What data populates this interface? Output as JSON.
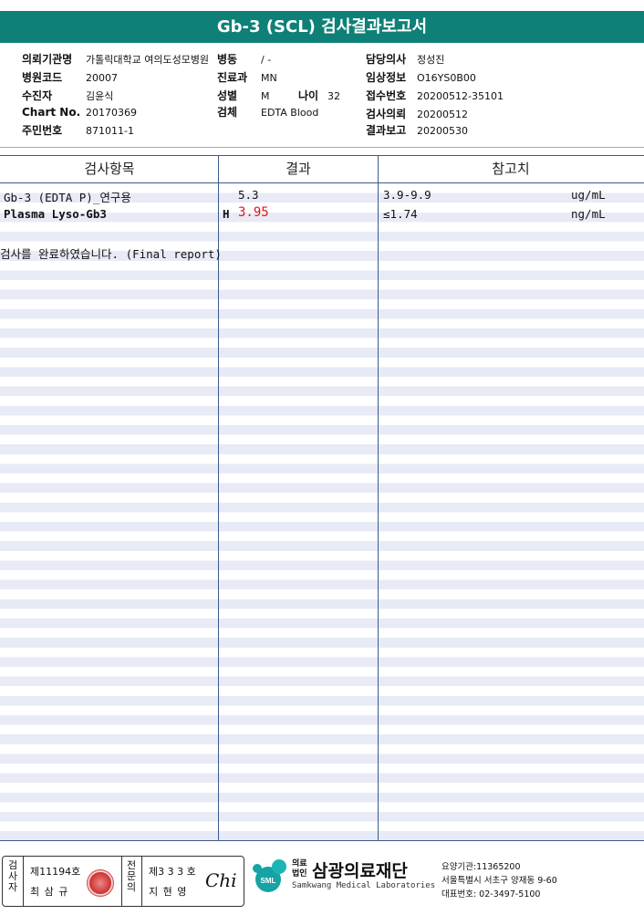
{
  "title": "Gb-3 (SCL) 검사결과보고서",
  "header": {
    "left": [
      {
        "key": "의뢰기관명",
        "value": "가톨릭대학교 여의도성모병원"
      },
      {
        "key": "병원코드",
        "value": "20007"
      },
      {
        "key": "수진자",
        "value": "김윤식"
      },
      {
        "key": "Chart No.",
        "value": "20170369"
      },
      {
        "key": "주민번호",
        "value": "871011-1"
      }
    ],
    "middle": [
      {
        "key": "병동",
        "value": "/ -"
      },
      {
        "key": "진료과",
        "value": "MN"
      },
      {
        "key": "성별",
        "value": "M"
      },
      {
        "key": "나이",
        "value": "32"
      },
      {
        "key": "검체",
        "value": "EDTA Blood"
      }
    ],
    "right": [
      {
        "key": "담당의사",
        "value": "정성진"
      },
      {
        "key": "임상정보",
        "value": "O16YS0B00"
      },
      {
        "key": "접수번호",
        "value": "20200512-35101"
      },
      {
        "key": "검사의뢰",
        "value": "20200512"
      },
      {
        "key": "결과보고",
        "value": "20200530"
      }
    ]
  },
  "table": {
    "columns": [
      "검사항목",
      "결과",
      "참고치"
    ],
    "rows": [
      {
        "item": "Gb-3 (EDTA P)_연구용",
        "flag": "",
        "result": "5.3",
        "reference": "3.9-9.9",
        "unit": "ug/mL"
      },
      {
        "item": "Plasma Lyso-Gb3",
        "flag": "H",
        "result": "3.95",
        "reference": "≤1.74",
        "unit": "ng/mL"
      }
    ],
    "note": "검사를  완료하였습니다. (Final report)"
  },
  "footer": {
    "sig1_label": "검사자",
    "sig1_no": "제11194호",
    "sig1_name": "최 삼 규",
    "sig2_label": "전문의",
    "sig2_no": "제3 3 3 호",
    "sig2_name": "지 현 영",
    "signature": "Chi",
    "logo_text": "SML",
    "org_prefix": "의료\n법인",
    "org_name": "삼광의료재단",
    "org_eng": "Samkwang Medical Laboratories",
    "addr1": "요양기관:11365200",
    "addr2": "서울특별시 서초구 양재동 9-60",
    "addr3": "대표번호: 02-3497-5100"
  },
  "colors": {
    "title_bg": "#0f8077",
    "stripe": "#e8ebf6",
    "flag_high": "#e0141c"
  }
}
